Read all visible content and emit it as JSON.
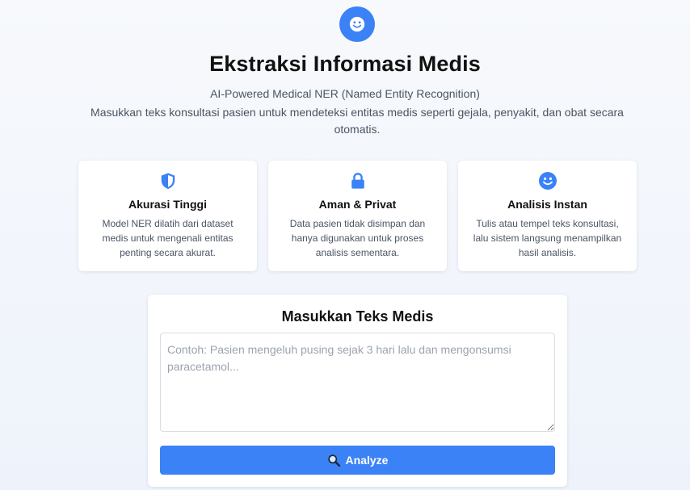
{
  "header": {
    "title": "Ekstraksi Informasi Medis",
    "subtitle": "AI-Powered Medical NER (Named Entity Recognition)",
    "description": "Masukkan teks konsultasi pasien untuk mendeteksi entitas medis seperti gejala, penyakit, dan obat secara otomatis.",
    "logo_icon": "smiley-face-icon"
  },
  "features": [
    {
      "icon": "shield-icon",
      "title": "Akurasi Tinggi",
      "text": "Model NER dilatih dari dataset medis untuk mengenali entitas penting secara akurat."
    },
    {
      "icon": "lock-icon",
      "title": "Aman & Privat",
      "text": "Data pasien tidak disimpan dan hanya digunakan untuk proses analisis sementara."
    },
    {
      "icon": "smiley-face-icon",
      "title": "Analisis Instan",
      "text": "Tulis atau tempel teks konsultasi, lalu sistem langsung menampilkan hasil analisis."
    }
  ],
  "input_panel": {
    "title": "Masukkan Teks Medis",
    "value": "",
    "placeholder": "Contoh: Pasien mengeluh pusing sejak 3 hari lalu dan mengonsumsi paracetamol...",
    "button_label": "Analyze",
    "button_icon": "magnifying-glass-icon"
  },
  "colors": {
    "accent": "#3b82f6",
    "background": "#f3f6fb",
    "card": "#ffffff",
    "text_primary": "#111111",
    "text_secondary": "#4b5563"
  }
}
